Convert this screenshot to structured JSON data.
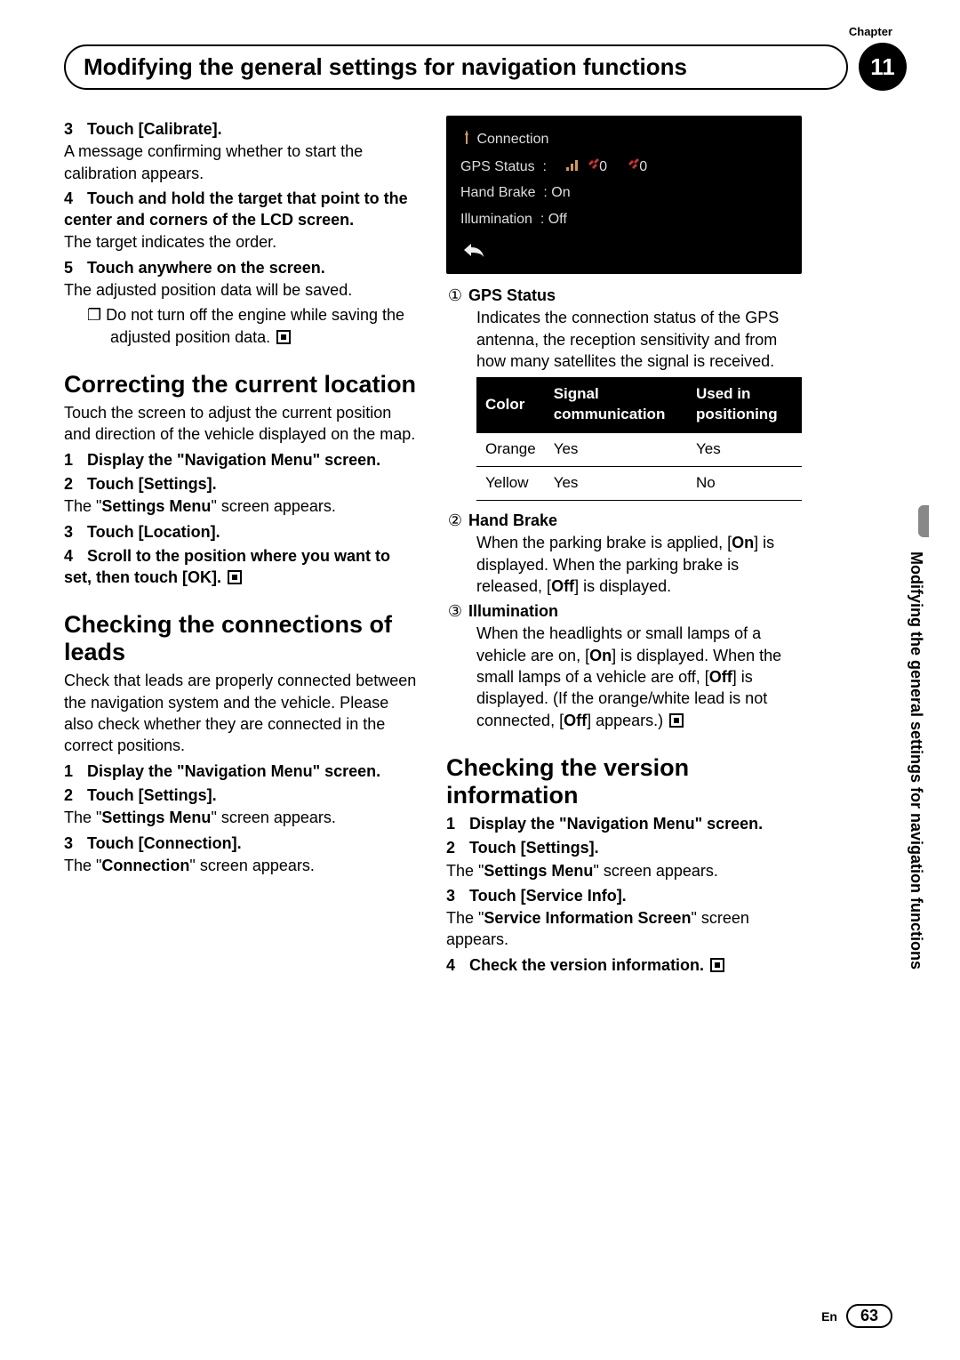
{
  "chapter_label": "Chapter",
  "chapter_number": "11",
  "page_title": "Modifying the general settings for navigation functions",
  "side_tab_text": "Modifying the general settings for navigation functions",
  "footer": {
    "lang": "En",
    "page": "63"
  },
  "left": {
    "s3_head": "Touch [Calibrate].",
    "s3_body": "A message confirming whether to start the calibration appears.",
    "s4_head": "Touch and hold the target that point to the center and corners of the LCD screen.",
    "s4_body": "The target indicates the order.",
    "s5_head": "Touch anywhere on the screen.",
    "s5_body": "The adjusted position data will be saved.",
    "s5_note": "Do not turn off the engine while saving the adjusted position data.",
    "h_correct": "Correcting the current location",
    "correct_body": "Touch the screen to adjust the current position and direction of the vehicle displayed on the map.",
    "c1": "Display the \"Navigation Menu\" screen.",
    "c2": "Touch [Settings].",
    "c2_body_a": "The \"",
    "c2_body_b": "Settings Menu",
    "c2_body_c": "\" screen appears.",
    "c3": "Touch [Location].",
    "c4": "Scroll to the position where you want to set, then touch [OK].",
    "h_leads": "Checking the connections of leads",
    "leads_body": "Check that leads are properly connected between the navigation system and the vehicle. Please also check whether they are connected in the correct positions.",
    "l1": "Display the \"Navigation Menu\" screen.",
    "l2": "Touch [Settings].",
    "l2_body_a": "The \"",
    "l2_body_b": "Settings Menu",
    "l2_body_c": "\" screen appears.",
    "l3": "Touch [Connection].",
    "l3_body_a": "The \"",
    "l3_body_b": "Connection",
    "l3_body_c": "\" screen appears."
  },
  "screenshot": {
    "title": "Connection",
    "gps_label": "GPS Status",
    "gps_sep": ":",
    "gps_sig_n": "0",
    "gps_sat_n": "0",
    "hand_label": "Hand Brake",
    "hand_val": ": On",
    "ill_label": "Illumination",
    "ill_val": ": Off"
  },
  "right": {
    "d1_label": "GPS Status",
    "d1_body": "Indicates the connection status of the GPS antenna, the reception sensitivity and from how many satellites the signal is received.",
    "table": {
      "h1": "Color",
      "h2": "Signal communication",
      "h3": "Used in positioning",
      "r1c1": "Orange",
      "r1c2": "Yes",
      "r1c3": "Yes",
      "r2c1": "Yellow",
      "r2c2": "Yes",
      "r2c3": "No"
    },
    "d2_label": "Hand Brake",
    "d2_body_a": "When the parking brake is applied, [",
    "d2_body_b": "On",
    "d2_body_c": "] is displayed. When the parking brake is released, [",
    "d2_body_d": "Off",
    "d2_body_e": "] is displayed.",
    "d3_label": "Illumination",
    "d3_body_a": "When the headlights or small lamps of a vehicle are on, [",
    "d3_body_b": "On",
    "d3_body_c": "] is displayed. When the small lamps of a vehicle are off, [",
    "d3_body_d": "Off",
    "d3_body_e": "] is displayed. (If the orange/white lead is not connected, [",
    "d3_body_f": "Off",
    "d3_body_g": "] appears.)",
    "h_ver": "Checking the version information",
    "v1": "Display the \"Navigation Menu\" screen.",
    "v2": "Touch [Settings].",
    "v2_body_a": "The \"",
    "v2_body_b": "Settings Menu",
    "v2_body_c": "\" screen appears.",
    "v3": "Touch [Service Info].",
    "v3_body_a": "The \"",
    "v3_body_b": "Service Information Screen",
    "v3_body_c": "\" screen appears.",
    "v4": "Check the version information."
  },
  "nums": {
    "n1": "1",
    "n2": "2",
    "n3": "3",
    "n4": "4",
    "n5": "5",
    "c1": "①",
    "c2": "②",
    "c3": "③",
    "bullet": "❐",
    "note": "❐"
  }
}
